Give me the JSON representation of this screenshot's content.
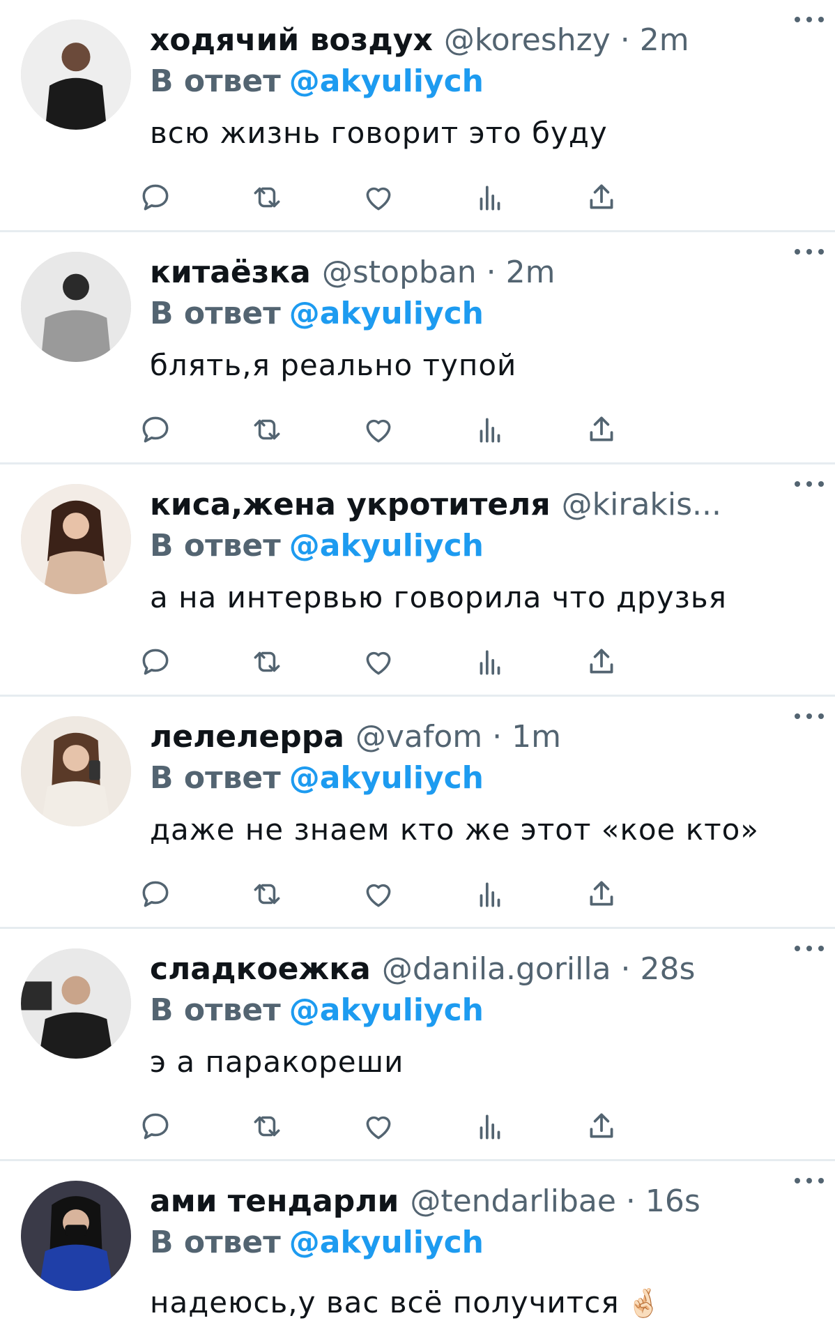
{
  "reply_prefix": "В ответ",
  "colors": {
    "text": "#0f1419",
    "secondary": "#536471",
    "link": "#1d9bf0",
    "divider": "#e6ecf0"
  },
  "icons": [
    "reply-icon",
    "retweet-icon",
    "like-icon",
    "views-icon",
    "share-icon",
    "more-icon"
  ],
  "tweets": [
    {
      "name": "ходячий воздух",
      "meta": "@koreshzy · 2m",
      "reply_to": "@akyuliych",
      "text": "всю жизнь говорит это буду"
    },
    {
      "name": "китаёзка",
      "meta": "@stopban · 2m",
      "reply_to": "@akyuliych",
      "text": "блять,я реально тупой"
    },
    {
      "name": "киса,жена укротителя",
      "meta": "@kirakis...",
      "reply_to": "@akyuliych",
      "text": "а на интервью говорила что друзья"
    },
    {
      "name": "лелелерра",
      "meta": "@vafom · 1m",
      "reply_to": "@akyuliych",
      "text": "даже не знаем кто же этот «кое кто»"
    },
    {
      "name": "сладкоежка",
      "meta": "@danila.gorilla · 28s",
      "reply_to": "@akyuliych",
      "text": "э а паракореши"
    },
    {
      "name": "ами тендарли",
      "meta": "@tendarlibae · 16s",
      "reply_to": "@akyuliych",
      "text": "надеюсь,у вас всё получится",
      "emoji": "🤞🏻"
    }
  ]
}
